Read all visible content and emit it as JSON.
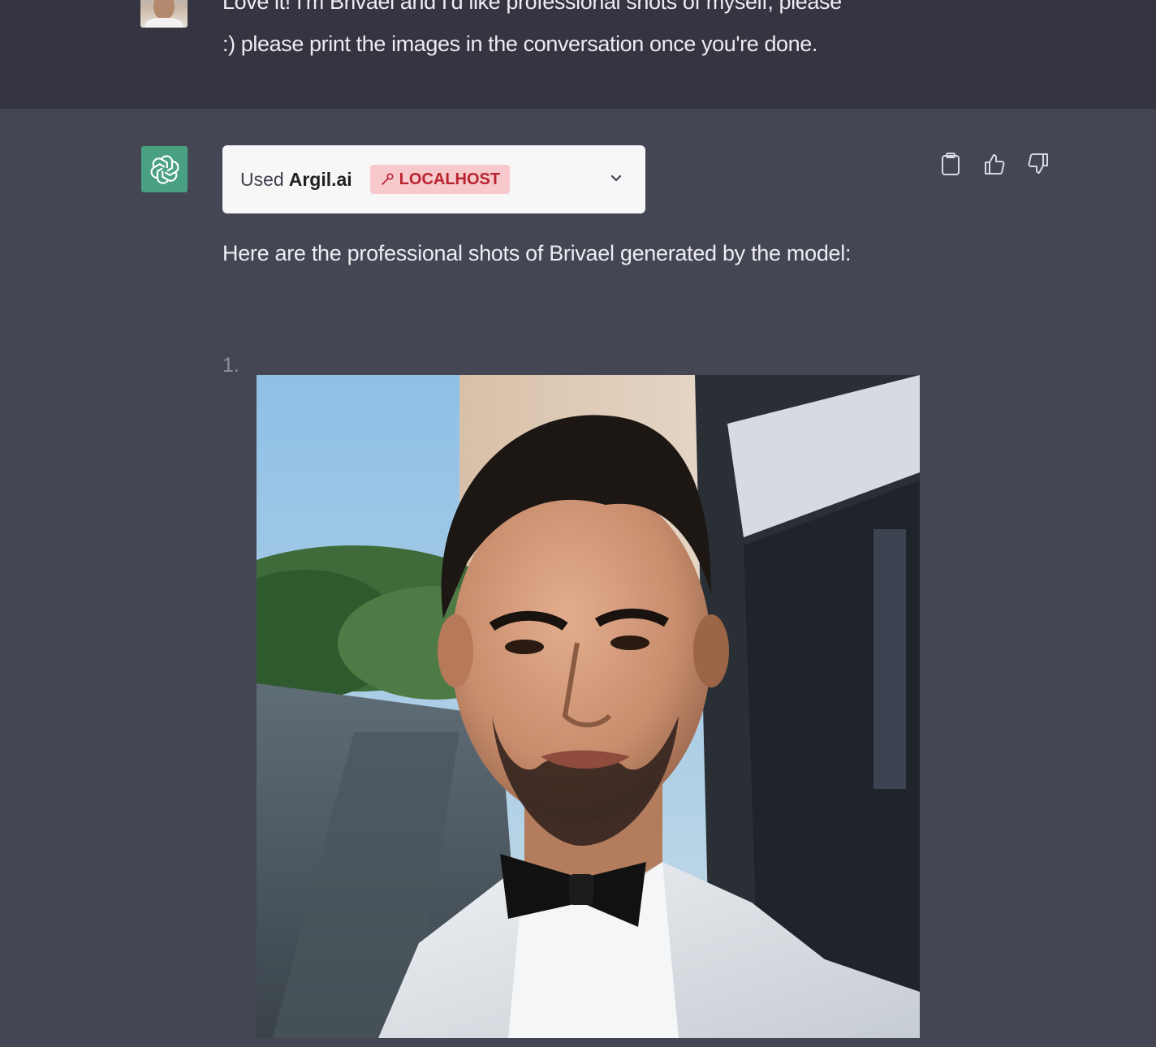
{
  "user_message": {
    "avatar_icon": "user-avatar",
    "lines": [
      "Love it! I'm Brivael and I'd like professional shots of myself, please",
      ":) please print the images in the conversation once you're done."
    ]
  },
  "assistant": {
    "avatar_icon": "openai-logo-icon",
    "tool": {
      "used_label": "Used",
      "plugin_name": "Argil.ai",
      "badge_label": "LOCALHOST",
      "badge_icon": "wrench-icon",
      "expand_icon": "chevron-down-icon"
    },
    "actions": {
      "copy_icon": "clipboard-icon",
      "like_icon": "thumbs-up-icon",
      "dislike_icon": "thumbs-down-icon"
    },
    "reply_text": "Here are the professional shots of Brivael generated by the model:",
    "list": [
      {
        "number": "1."
      }
    ]
  },
  "colors": {
    "user_bg": "#343541",
    "assistant_bg": "#444654",
    "text": "#ececf1",
    "badge_bg": "#f7c9cc",
    "badge_text": "#b8232f",
    "avatar_green": "#4aa181"
  }
}
